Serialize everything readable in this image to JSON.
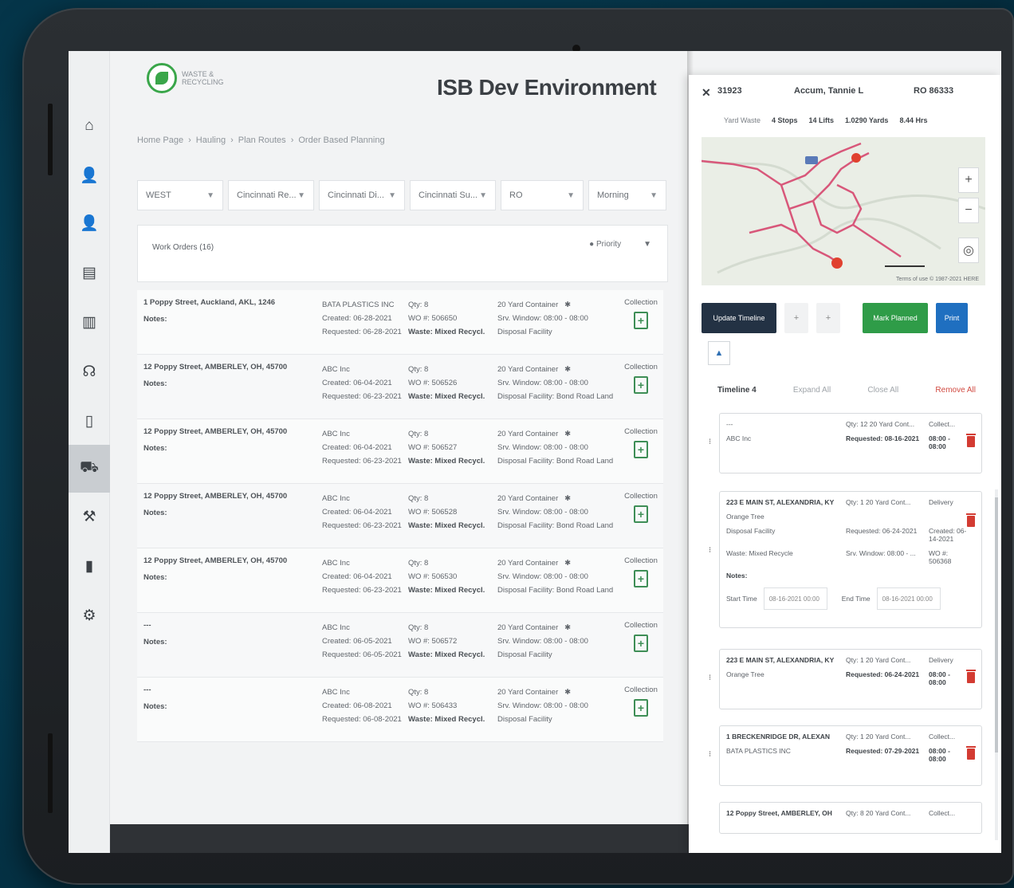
{
  "app_title": "ISB Dev Environment",
  "logo_text": [
    "WASTE &",
    "RECYCLING"
  ],
  "breadcrumb": [
    "Home Page",
    "Hauling",
    "Plan Routes",
    "Order Based Planning"
  ],
  "filters": [
    "WEST",
    "Cincinnati Re...",
    "Cincinnati Di...",
    "Cincinnati Su...",
    "RO",
    "Morning"
  ],
  "work_orders": {
    "title": "Work Orders (16)",
    "sort": "Priority"
  },
  "rows": [
    {
      "address": "1 Poppy Street, Auckland, AKL, 1246",
      "notes": "Notes:",
      "customer": "BATA PLASTICS INC",
      "created": "Created: 06-28-2021",
      "requested": "Requested: 06-28-2021",
      "qty": "Qty: 8",
      "wo": "WO #: 506650",
      "waste": "Waste: Mixed Recycl.",
      "container": "20 Yard Container",
      "window": "Srv. Window: 08:00 - 08:00",
      "facility": "Disposal Facility",
      "type": "Collection"
    },
    {
      "address": "12 Poppy Street, AMBERLEY, OH, 45700",
      "notes": "Notes:",
      "customer": "ABC Inc",
      "created": "Created: 06-04-2021",
      "requested": "Requested: 06-23-2021",
      "qty": "Qty: 8",
      "wo": "WO #: 506526",
      "waste": "Waste: Mixed Recycl.",
      "container": "20 Yard Container",
      "window": "Srv. Window: 08:00 - 08:00",
      "facility": "Disposal Facility: Bond Road Land",
      "type": "Collection"
    },
    {
      "address": "12 Poppy Street, AMBERLEY, OH, 45700",
      "notes": "Notes:",
      "customer": "ABC Inc",
      "created": "Created: 06-04-2021",
      "requested": "Requested: 06-23-2021",
      "qty": "Qty: 8",
      "wo": "WO #: 506527",
      "waste": "Waste: Mixed Recycl.",
      "container": "20 Yard Container",
      "window": "Srv. Window: 08:00 - 08:00",
      "facility": "Disposal Facility: Bond Road Land",
      "type": "Collection"
    },
    {
      "address": "12 Poppy Street, AMBERLEY, OH, 45700",
      "notes": "Notes:",
      "customer": "ABC Inc",
      "created": "Created: 06-04-2021",
      "requested": "Requested: 06-23-2021",
      "qty": "Qty: 8",
      "wo": "WO #: 506528",
      "waste": "Waste: Mixed Recycl.",
      "container": "20 Yard Container",
      "window": "Srv. Window: 08:00 - 08:00",
      "facility": "Disposal Facility: Bond Road Land",
      "type": "Collection"
    },
    {
      "address": "12 Poppy Street, AMBERLEY, OH, 45700",
      "notes": "Notes:",
      "customer": "ABC Inc",
      "created": "Created: 06-04-2021",
      "requested": "Requested: 06-23-2021",
      "qty": "Qty: 8",
      "wo": "WO #: 506530",
      "waste": "Waste: Mixed Recycl.",
      "container": "20 Yard Container",
      "window": "Srv. Window: 08:00 - 08:00",
      "facility": "Disposal Facility: Bond Road Land",
      "type": "Collection"
    },
    {
      "address": "---",
      "notes": "Notes:",
      "customer": "ABC Inc",
      "created": "Created: 06-05-2021",
      "requested": "Requested: 06-05-2021",
      "qty": "Qty: 8",
      "wo": "WO #: 506572",
      "waste": "Waste: Mixed Recycl.",
      "container": "20 Yard Container",
      "window": "Srv. Window: 08:00 - 08:00",
      "facility": "Disposal Facility",
      "type": "Collection"
    },
    {
      "address": "---",
      "notes": "Notes:",
      "customer": "ABC Inc",
      "created": "Created: 06-08-2021",
      "requested": "Requested: 06-08-2021",
      "qty": "Qty: 8",
      "wo": "WO #: 506433",
      "waste": "Waste: Mixed Recycl.",
      "container": "20 Yard Container",
      "window": "Srv. Window: 08:00 - 08:00",
      "facility": "Disposal Facility",
      "type": "Collection"
    }
  ],
  "drawer": {
    "close": "✕",
    "route_id": "31923",
    "driver": "Accum, Tannie L",
    "route_code": "RO 86333",
    "summary": [
      "Yard Waste",
      "4 Stops",
      "14 Lifts",
      "1.0290 Yards",
      "8.44 Hrs"
    ],
    "map_footer": "Terms of use  © 1987-2021 HERE",
    "actions": {
      "update": "Update Timeline",
      "minus": "+",
      "plus": "+",
      "mark_planned": "Mark Planned",
      "print": "Print",
      "small": "▲"
    },
    "timeline": {
      "title": "Timeline 4",
      "expand": "Expand All",
      "close": "Close All",
      "remove": "Remove All"
    },
    "cards": [
      {
        "title": "---",
        "customer": "ABC Inc",
        "qty": "Qty: 12 20 Yard Cont...",
        "type": "Collect...",
        "requested": "Requested: 08-16-2021",
        "time": "08:00 - 08:00"
      },
      {
        "title": "223 E MAIN ST, ALEXANDRIA, KY",
        "customer": "Orange Tree",
        "qty": "Qty: 1  20 Yard Cont...",
        "type": "Delivery",
        "facility": "Disposal Facility",
        "requested": "Requested: 06-24-2021",
        "created": "Created: 06-14-2021",
        "waste": "Waste: Mixed Recycle",
        "window": "Srv. Window: 08:00 - ...",
        "wo": "WO #: 506368",
        "notes": "Notes:",
        "start_label": "Start Time",
        "start_val": "08-16-2021 00:00",
        "end_label": "End Time",
        "end_val": "08-16-2021 00:00"
      },
      {
        "title": "223 E MAIN ST, ALEXANDRIA, KY",
        "customer": "Orange Tree",
        "qty": "Qty: 1  20 Yard Cont...",
        "type": "Delivery",
        "requested": "Requested: 06-24-2021",
        "time": "08:00 - 08:00"
      },
      {
        "title": "1 BRECKENRIDGE DR, ALEXAN",
        "customer": "BATA PLASTICS INC",
        "qty": "Qty: 1  20 Yard Cont...",
        "type": "Collect...",
        "requested": "Requested: 07-29-2021",
        "time": "08:00 - 08:00"
      },
      {
        "title": "12 Poppy Street, AMBERLEY, OH",
        "qty": "Qty: 8  20 Yard Cont...",
        "type": "Collect..."
      }
    ]
  },
  "colors": {
    "accent_green": "#2f9c48",
    "accent_blue": "#1f6fc0",
    "dark_btn": "#233244",
    "danger": "#d33b32"
  }
}
